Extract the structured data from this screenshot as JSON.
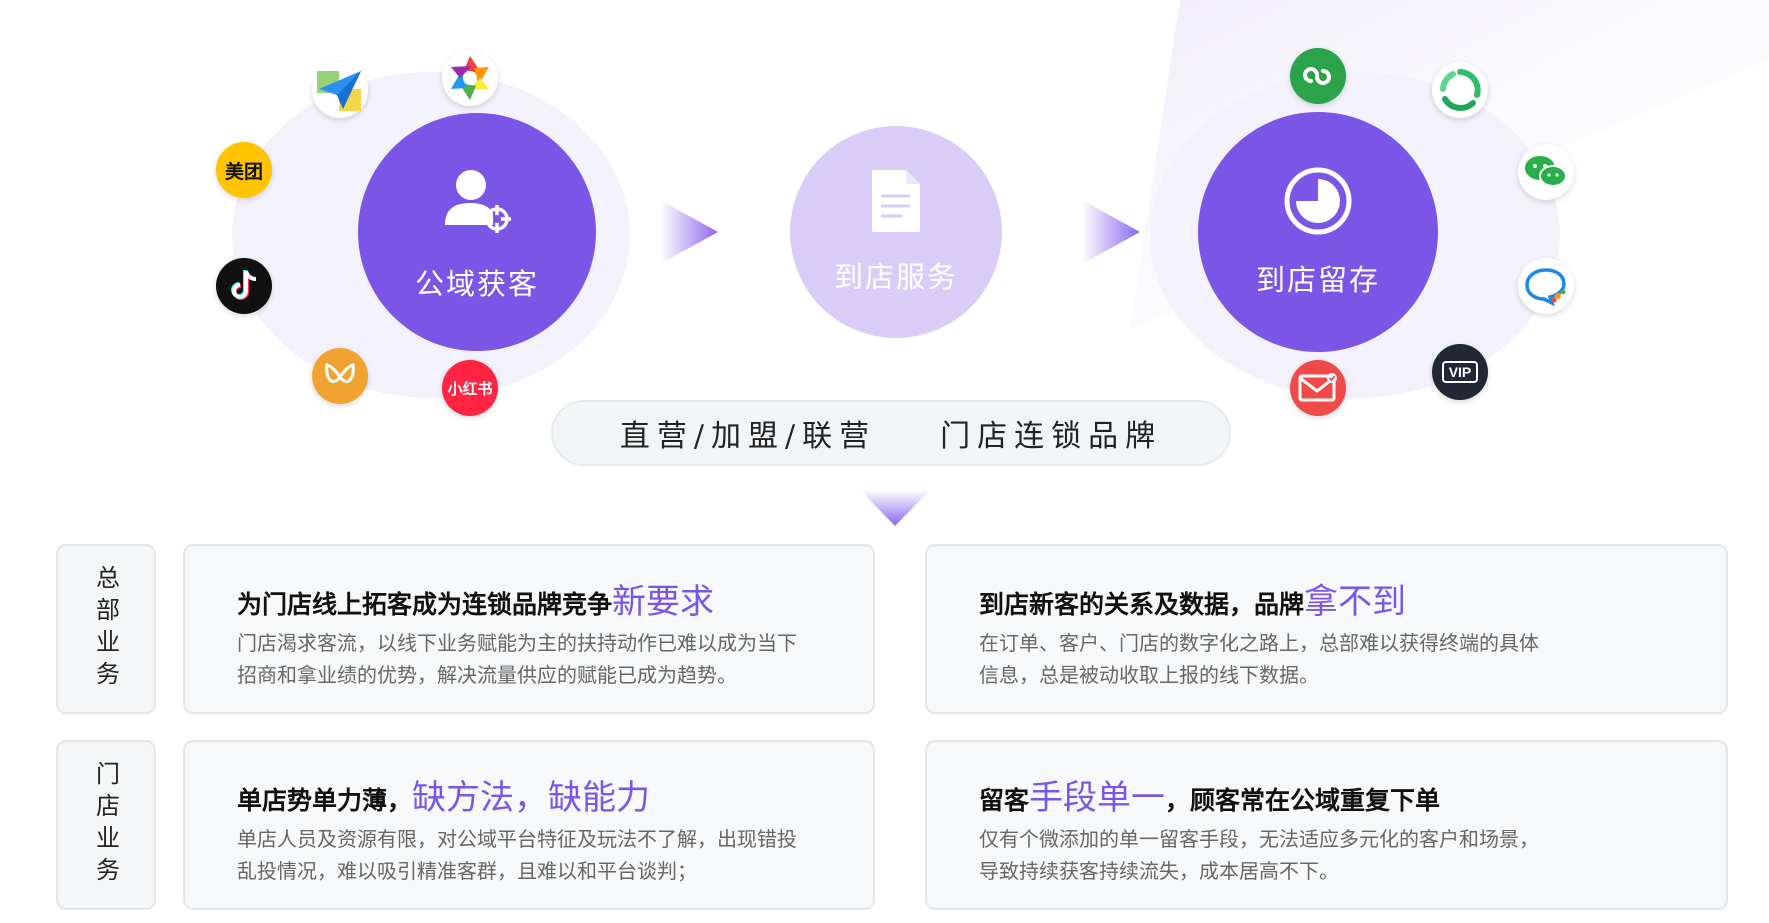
{
  "stages": [
    {
      "label": "公域获客",
      "icon": "user-target-icon"
    },
    {
      "label": "到店服务",
      "icon": "document-icon"
    },
    {
      "label": "到店留存",
      "icon": "pie-clock-icon"
    }
  ],
  "left_apps": [
    {
      "icon": "paper-plane-map-icon"
    },
    {
      "icon": "camera-aperture-icon"
    },
    {
      "icon": "meituan-icon",
      "text": "美团"
    },
    {
      "icon": "tiktok-icon"
    },
    {
      "icon": "w-butterfly-icon"
    },
    {
      "icon": "xiaohongshu-icon",
      "text": "小红书"
    }
  ],
  "right_apps": [
    {
      "icon": "mini-program-icon"
    },
    {
      "icon": "green-swirl-icon"
    },
    {
      "icon": "wechat-icon"
    },
    {
      "icon": "chat-bubble-icon"
    },
    {
      "icon": "vip-icon",
      "text": "VIP"
    },
    {
      "icon": "mail-icon"
    }
  ],
  "banner": {
    "left": "直营/加盟/联营",
    "right": "门店连锁品牌"
  },
  "rows": [
    {
      "side_label": "总部业务",
      "cards": [
        {
          "title": "为门店线上拓客成为连锁品牌竞争",
          "highlight": "新要求",
          "title_after": "",
          "body_1": "门店渴求客流，以线下业务赋能为主的扶持动作已难以成为当下",
          "body_2": "招商和拿业绩的优势，解决流量供应的赋能已成为趋势。"
        },
        {
          "title": "到店新客的关系及数据，品牌",
          "highlight": "拿不到",
          "title_after": "",
          "body_1": "在订单、客户、门店的数字化之路上，总部难以获得终端的具体",
          "body_2": "信息，总是被动收取上报的线下数据。"
        }
      ]
    },
    {
      "side_label": "门店业务",
      "cards": [
        {
          "title": "单店势单力薄，",
          "highlight": "缺方法，缺能力",
          "title_after": "",
          "body_1": "单店人员及资源有限，对公域平台特征及玩法不了解，出现错投",
          "body_2": "乱投情况，难以吸引精准客群，且难以和平台谈判；"
        },
        {
          "title": "留客",
          "highlight": "手段单一",
          "title_after": "，顾客常在公域重复下单",
          "body_1": "仅有个微添加的单一留客手段，无法适应多元化的客户和场景，",
          "body_2": "导致持续获客持续流失，成本居高不下。"
        }
      ]
    }
  ],
  "colors": {
    "accent": "#7b56e6",
    "light": "#d9cdf8",
    "glow": "#f1eefc"
  }
}
